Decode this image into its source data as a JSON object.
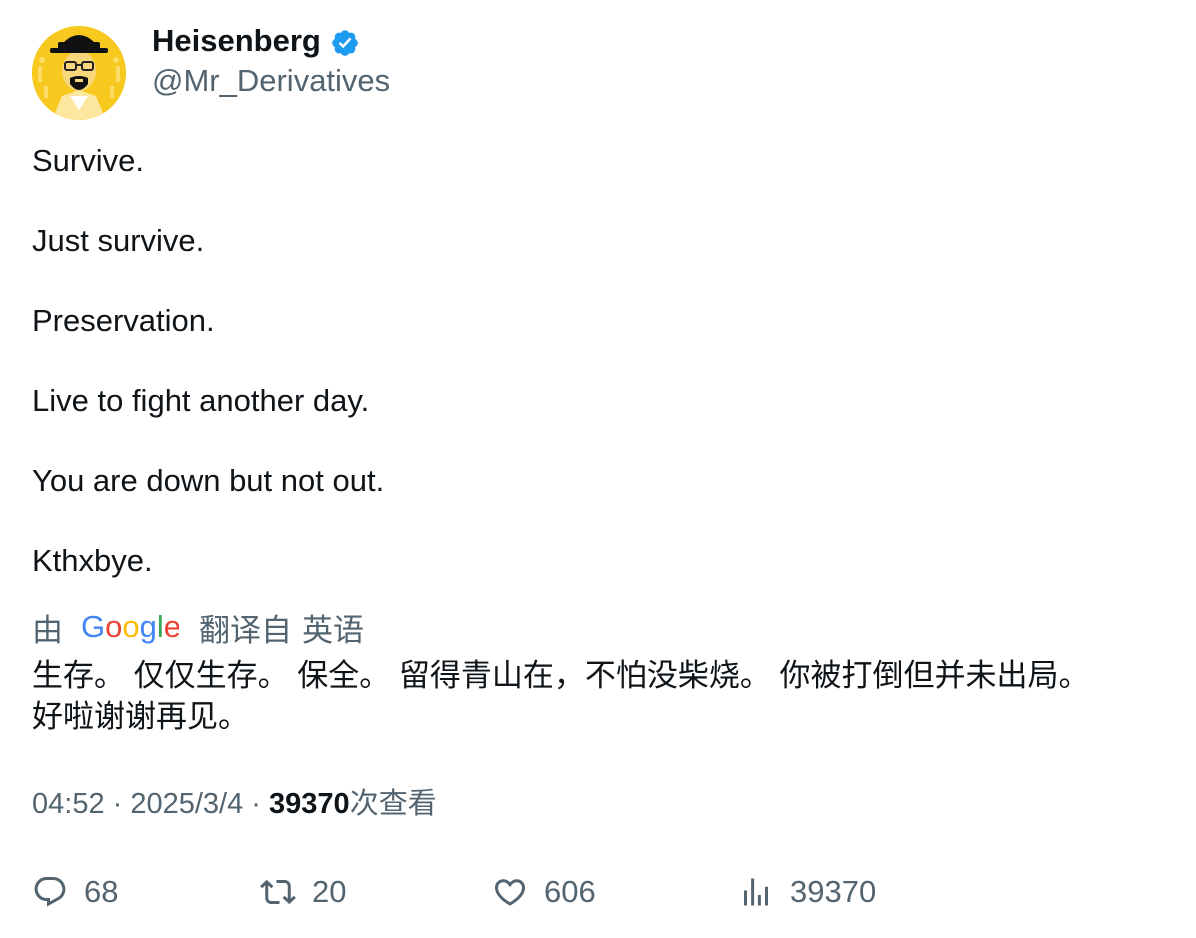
{
  "author": {
    "display_name": "Heisenberg",
    "handle": "@Mr_Derivatives",
    "verified": true,
    "verified_color": "#1d9bf0",
    "avatar_bg": "#f5c518"
  },
  "tweet": {
    "lines": [
      "Survive.",
      "",
      "Just survive.",
      "",
      "Preservation.",
      "",
      "Live to fight another day.",
      "",
      "You are down but not out.",
      "",
      "Kthxbye."
    ]
  },
  "translation": {
    "by_label": "由",
    "provider": "Google",
    "from_label": "翻译自",
    "language": "英语",
    "lines": [
      "生存。 仅仅生存。 保全。 留得青山在，不怕没柴烧。 你被打倒但并未出局。",
      "好啦谢谢再见。"
    ]
  },
  "meta": {
    "time": "04:52",
    "separator": " · ",
    "date": "2025/3/4",
    "views_count": "39370",
    "views_label": "次查看"
  },
  "actions": {
    "replies": "68",
    "retweets": "20",
    "likes": "606",
    "views": "39370"
  },
  "colors": {
    "text": "#0f1419",
    "secondary": "#536471"
  }
}
